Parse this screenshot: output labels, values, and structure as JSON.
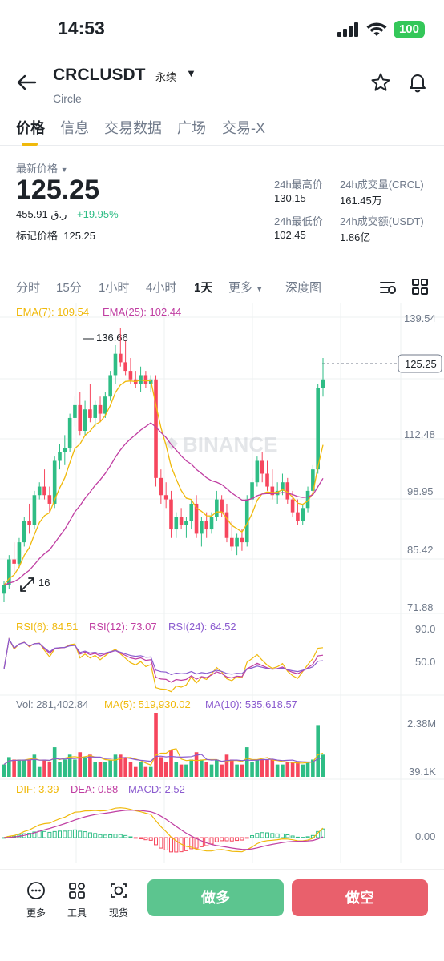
{
  "status": {
    "time": "14:53",
    "battery": "100"
  },
  "header": {
    "symbol": "CRCLUSDT",
    "contract": "永续",
    "name": "Circle"
  },
  "tabs": [
    "价格",
    "信息",
    "交易数据",
    "广场",
    "交易-X"
  ],
  "price": {
    "latest_label": "最新价格",
    "last": "125.25",
    "fiat": "455.91 ر.ق",
    "change": "+19.95%",
    "mark_label": "标记价格",
    "mark": "125.25"
  },
  "stats": {
    "high_label": "24h最高价",
    "high": "130.15",
    "low_label": "24h最低价",
    "low": "102.45",
    "vol_label": "24h成交量(CRCL)",
    "vol": "161.45万",
    "amt_label": "24h成交额(USDT)",
    "amt": "1.86亿"
  },
  "intervals": [
    "分时",
    "15分",
    "1小时",
    "4小时",
    "1天",
    "更多",
    "深度图"
  ],
  "indicators": {
    "ema7": "EMA(7): 109.54",
    "ema25": "EMA(25): 102.44",
    "rsi6": "RSI(6): 84.51",
    "rsi12": "RSI(12): 73.07",
    "rsi24": "RSI(24): 64.52",
    "vol": "Vol: 281,402.84",
    "vol_ma5": "MA(5): 519,930.02",
    "vol_ma10": "MA(10): 535,618.57",
    "dif": "DIF: 3.39",
    "dea": "DEA: 0.88",
    "macd": "MACD: 2.52"
  },
  "axes": {
    "price": [
      "139.54",
      "112.48",
      "98.95",
      "85.42",
      "71.88"
    ],
    "current": "125.25",
    "high_marker": "136.66",
    "low_marker": "16",
    "rsi": [
      "90.0",
      "50.0"
    ],
    "vol": [
      "2.38M",
      "39.1K"
    ],
    "macd": [
      "0.00"
    ],
    "watermark": "BINANCE"
  },
  "colors": {
    "up": "#2ebd85",
    "down": "#f6465d",
    "ema7": "#f0b90b",
    "ema25": "#c03ea2",
    "brand": "#f0b90b"
  },
  "bottom": {
    "more": "更多",
    "tools": "工具",
    "spot": "现货",
    "long": "做多",
    "short": "做空"
  },
  "chart_data": {
    "type": "candlestick",
    "interval": "1天",
    "ylim": [
      71.88,
      139.54
    ],
    "candles": [
      [
        75,
        78,
        73,
        77
      ],
      [
        77,
        84,
        76,
        83
      ],
      [
        83,
        87,
        80,
        82
      ],
      [
        82,
        88,
        81,
        87
      ],
      [
        87,
        93,
        86,
        92
      ],
      [
        92,
        96,
        89,
        91
      ],
      [
        91,
        99,
        90,
        98
      ],
      [
        98,
        101,
        97,
        100
      ],
      [
        100,
        104,
        97,
        98
      ],
      [
        98,
        100,
        94,
        96
      ],
      [
        96,
        107,
        95,
        106
      ],
      [
        106,
        110,
        104,
        108
      ],
      [
        108,
        112,
        105,
        109
      ],
      [
        109,
        117,
        108,
        116
      ],
      [
        116,
        121,
        114,
        119
      ],
      [
        119,
        122,
        112,
        113
      ],
      [
        113,
        120,
        112,
        118
      ],
      [
        118,
        124,
        115,
        116
      ],
      [
        116,
        120,
        114,
        119
      ],
      [
        119,
        121,
        115,
        117
      ],
      [
        117,
        122,
        116,
        121
      ],
      [
        121,
        127,
        120,
        126
      ],
      [
        126,
        133,
        124,
        131
      ],
      [
        131,
        137,
        128,
        129
      ],
      [
        129,
        134,
        126,
        127
      ],
      [
        127,
        130,
        124,
        125
      ],
      [
        125,
        127,
        123,
        124
      ],
      [
        124,
        128,
        122,
        126
      ],
      [
        126,
        127,
        123,
        124
      ],
      [
        124,
        126,
        122,
        125
      ],
      [
        125,
        126,
        100,
        102
      ],
      [
        102,
        104,
        96,
        98
      ],
      [
        98,
        101,
        95,
        97
      ],
      [
        97,
        99,
        88,
        90
      ],
      [
        90,
        94,
        88,
        93
      ],
      [
        93,
        95,
        90,
        91
      ],
      [
        91,
        93,
        88,
        92
      ],
      [
        92,
        97,
        90,
        96
      ],
      [
        96,
        98,
        88,
        89
      ],
      [
        89,
        93,
        86,
        92
      ],
      [
        92,
        94,
        88,
        90
      ],
      [
        90,
        94,
        89,
        93
      ],
      [
        93,
        99,
        92,
        97
      ],
      [
        97,
        98,
        93,
        94
      ],
      [
        94,
        96,
        87,
        88
      ],
      [
        88,
        92,
        85,
        86
      ],
      [
        86,
        89,
        84,
        88
      ],
      [
        88,
        90,
        85,
        87
      ],
      [
        87,
        98,
        86,
        97
      ],
      [
        97,
        102,
        96,
        101
      ],
      [
        101,
        107,
        100,
        106
      ],
      [
        106,
        108,
        101,
        103
      ],
      [
        103,
        106,
        99,
        100
      ],
      [
        100,
        104,
        97,
        98
      ],
      [
        98,
        101,
        96,
        99
      ],
      [
        99,
        103,
        98,
        101
      ],
      [
        101,
        102,
        96,
        97
      ],
      [
        97,
        99,
        93,
        94
      ],
      [
        94,
        97,
        91,
        92
      ],
      [
        92,
        96,
        91,
        95
      ],
      [
        95,
        100,
        94,
        99
      ],
      [
        99,
        105,
        98,
        104
      ],
      [
        104,
        124,
        103,
        123
      ],
      [
        123,
        130,
        121,
        125
      ]
    ]
  }
}
